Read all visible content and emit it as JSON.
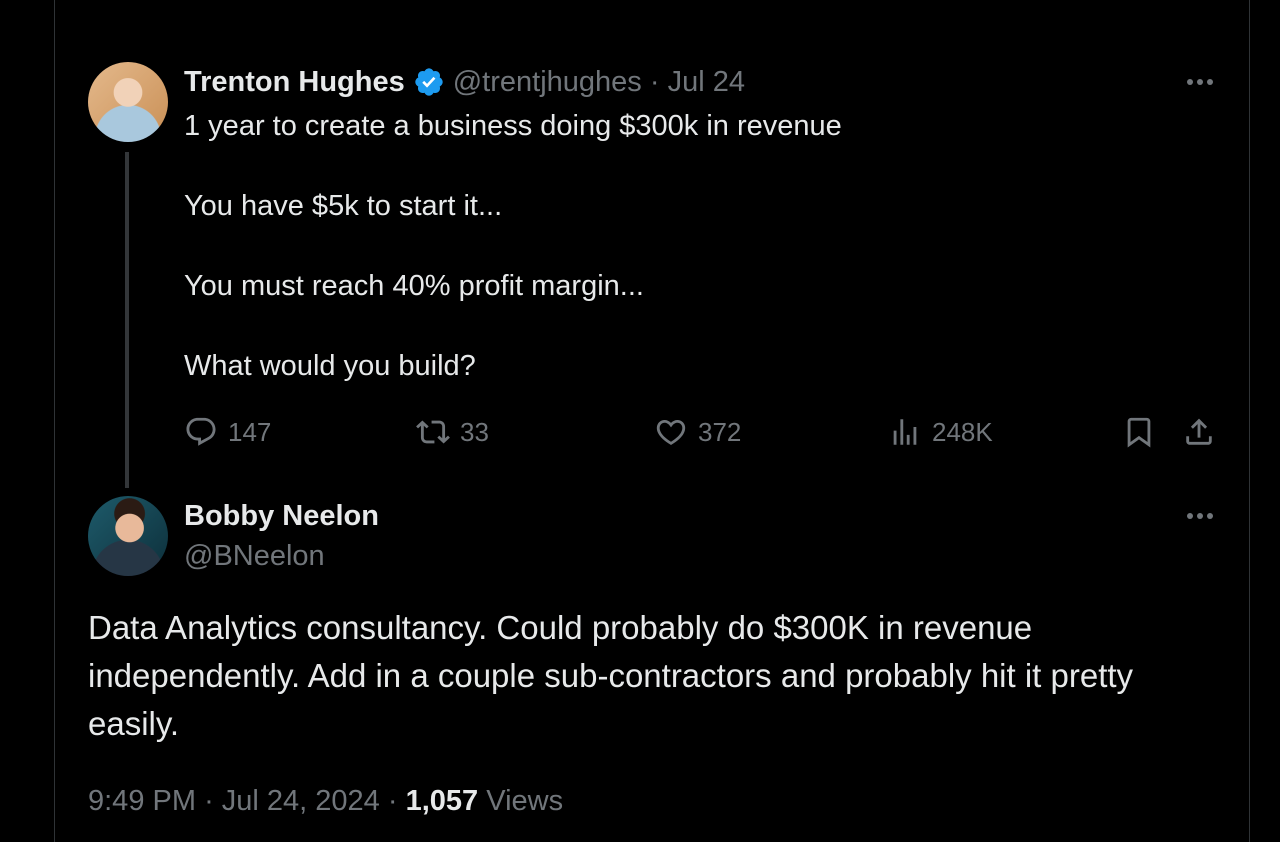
{
  "original_tweet": {
    "author_name": "Trenton Hughes",
    "author_handle": "@trentjhughes",
    "separator": "·",
    "date": "Jul 24",
    "verified": true,
    "text": "1 year to create a business doing $300k in revenue\n\nYou have $5k to start it...\n\nYou must reach 40% profit margin...\n\nWhat would you build?",
    "stats": {
      "replies": "147",
      "reposts": "33",
      "likes": "372",
      "views": "248K"
    }
  },
  "reply_tweet": {
    "author_name": "Bobby Neelon",
    "author_handle": "@BNeelon",
    "text": "Data Analytics consultancy.  Could probably do $300K in revenue independently. Add in a couple sub-contractors and probably hit it pretty easily.",
    "time": "9:49 PM",
    "separator": "·",
    "date": "Jul 24, 2024",
    "views_count": "1,057",
    "views_label": "Views"
  },
  "icons": {
    "verified": "verified-badge-icon",
    "more": "more-options-icon",
    "reply": "reply-icon",
    "repost": "repost-icon",
    "like": "heart-icon",
    "views": "analytics-icon",
    "bookmark": "bookmark-icon",
    "share": "share-icon"
  },
  "colors": {
    "background": "#000000",
    "text_primary": "#e7e9ea",
    "text_muted": "#71767b",
    "verified_blue": "#1d9bf0",
    "border": "#2f3336"
  }
}
